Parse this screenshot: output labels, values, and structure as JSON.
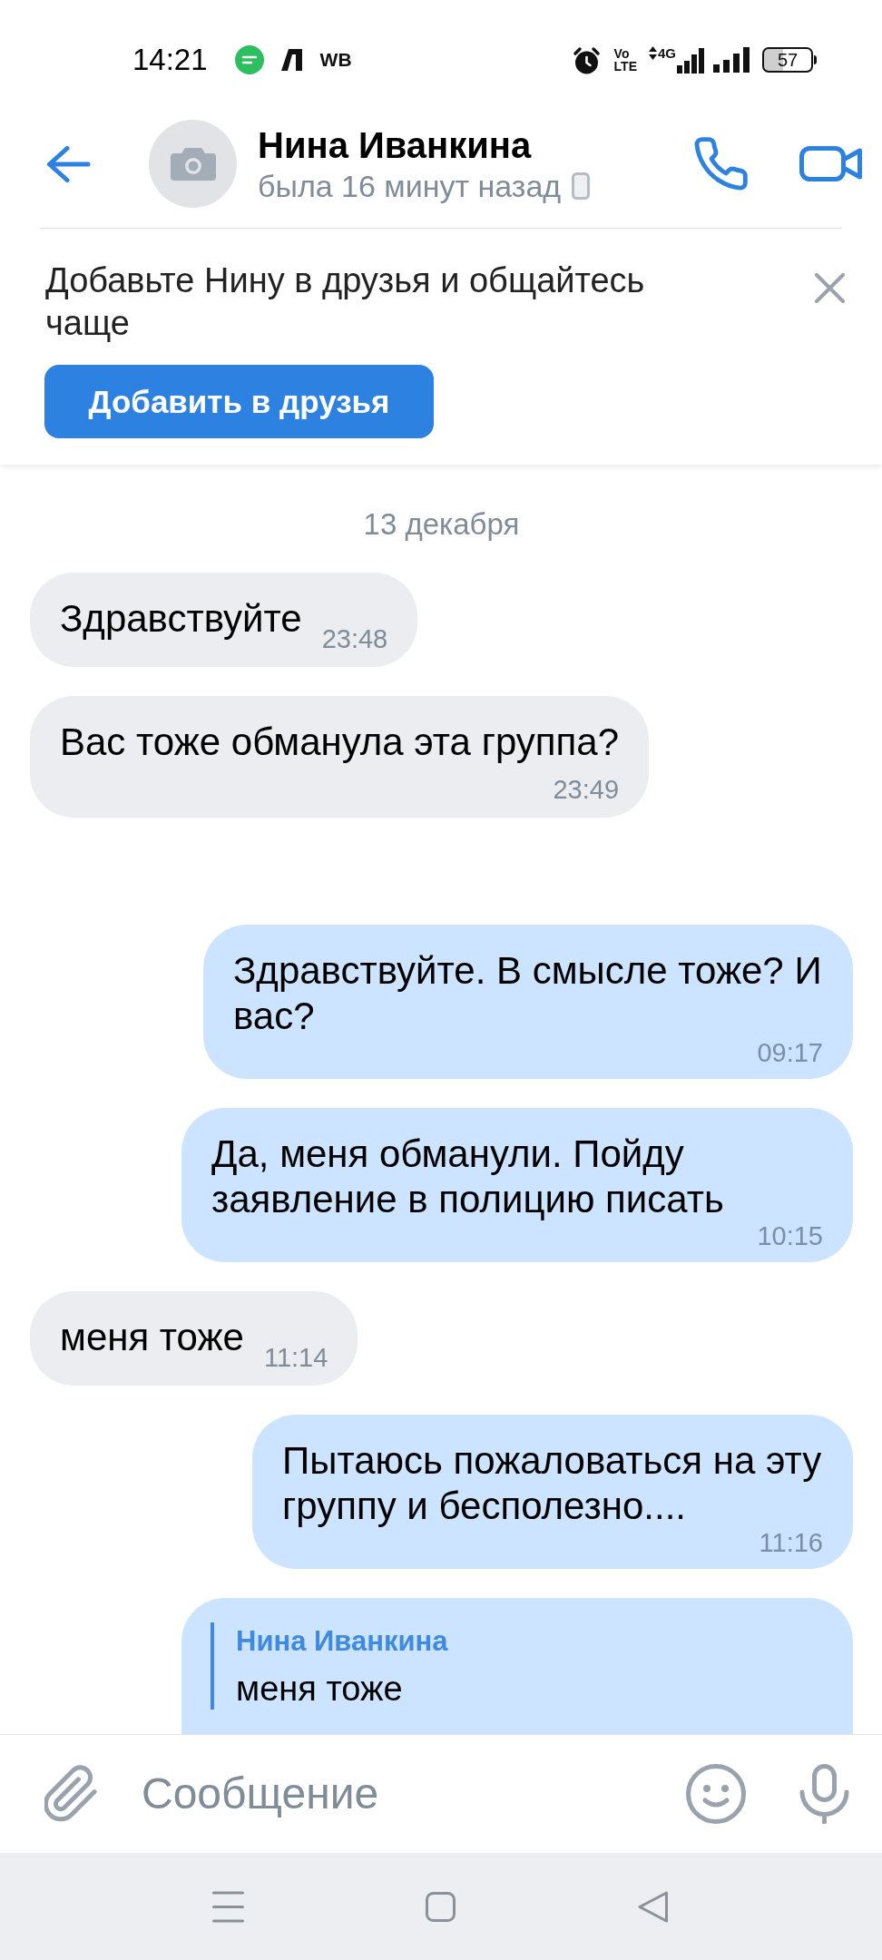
{
  "status_bar": {
    "time": "14:21",
    "notification_label": "WB",
    "volte": "Vo LTE",
    "network": "4G",
    "battery": "57"
  },
  "header": {
    "name": "Нина Иванкина",
    "last_seen": "была 16 минут назад"
  },
  "friend_banner": {
    "text": "Добавьте Нину в друзья и общайтесь чаще",
    "button": "Добавить в друзья"
  },
  "date_separator": "13 декабря",
  "messages": [
    {
      "kind": "incoming",
      "text": "Здравствуйте",
      "time": "23:48"
    },
    {
      "kind": "incoming",
      "text": "Вас тоже обманула эта группа?",
      "time": "23:49"
    },
    {
      "kind": "outgoing",
      "text": "Здравствуйте. В смысле тоже? И вас?",
      "time": "09:17"
    },
    {
      "kind": "outgoing",
      "text": "Да, меня обманули. Пойду заявление в полицию писать",
      "time": "10:15"
    },
    {
      "kind": "incoming",
      "text": "меня тоже",
      "time": "11:14"
    },
    {
      "kind": "outgoing",
      "text": "Пытаюсь пожаловаться на эту группу и бесполезно....",
      "time": "11:16"
    },
    {
      "kind": "outgoing",
      "reply": {
        "author": "Нина Иванкина",
        "text": "меня тоже"
      }
    }
  ],
  "composer": {
    "placeholder": "Сообщение"
  }
}
